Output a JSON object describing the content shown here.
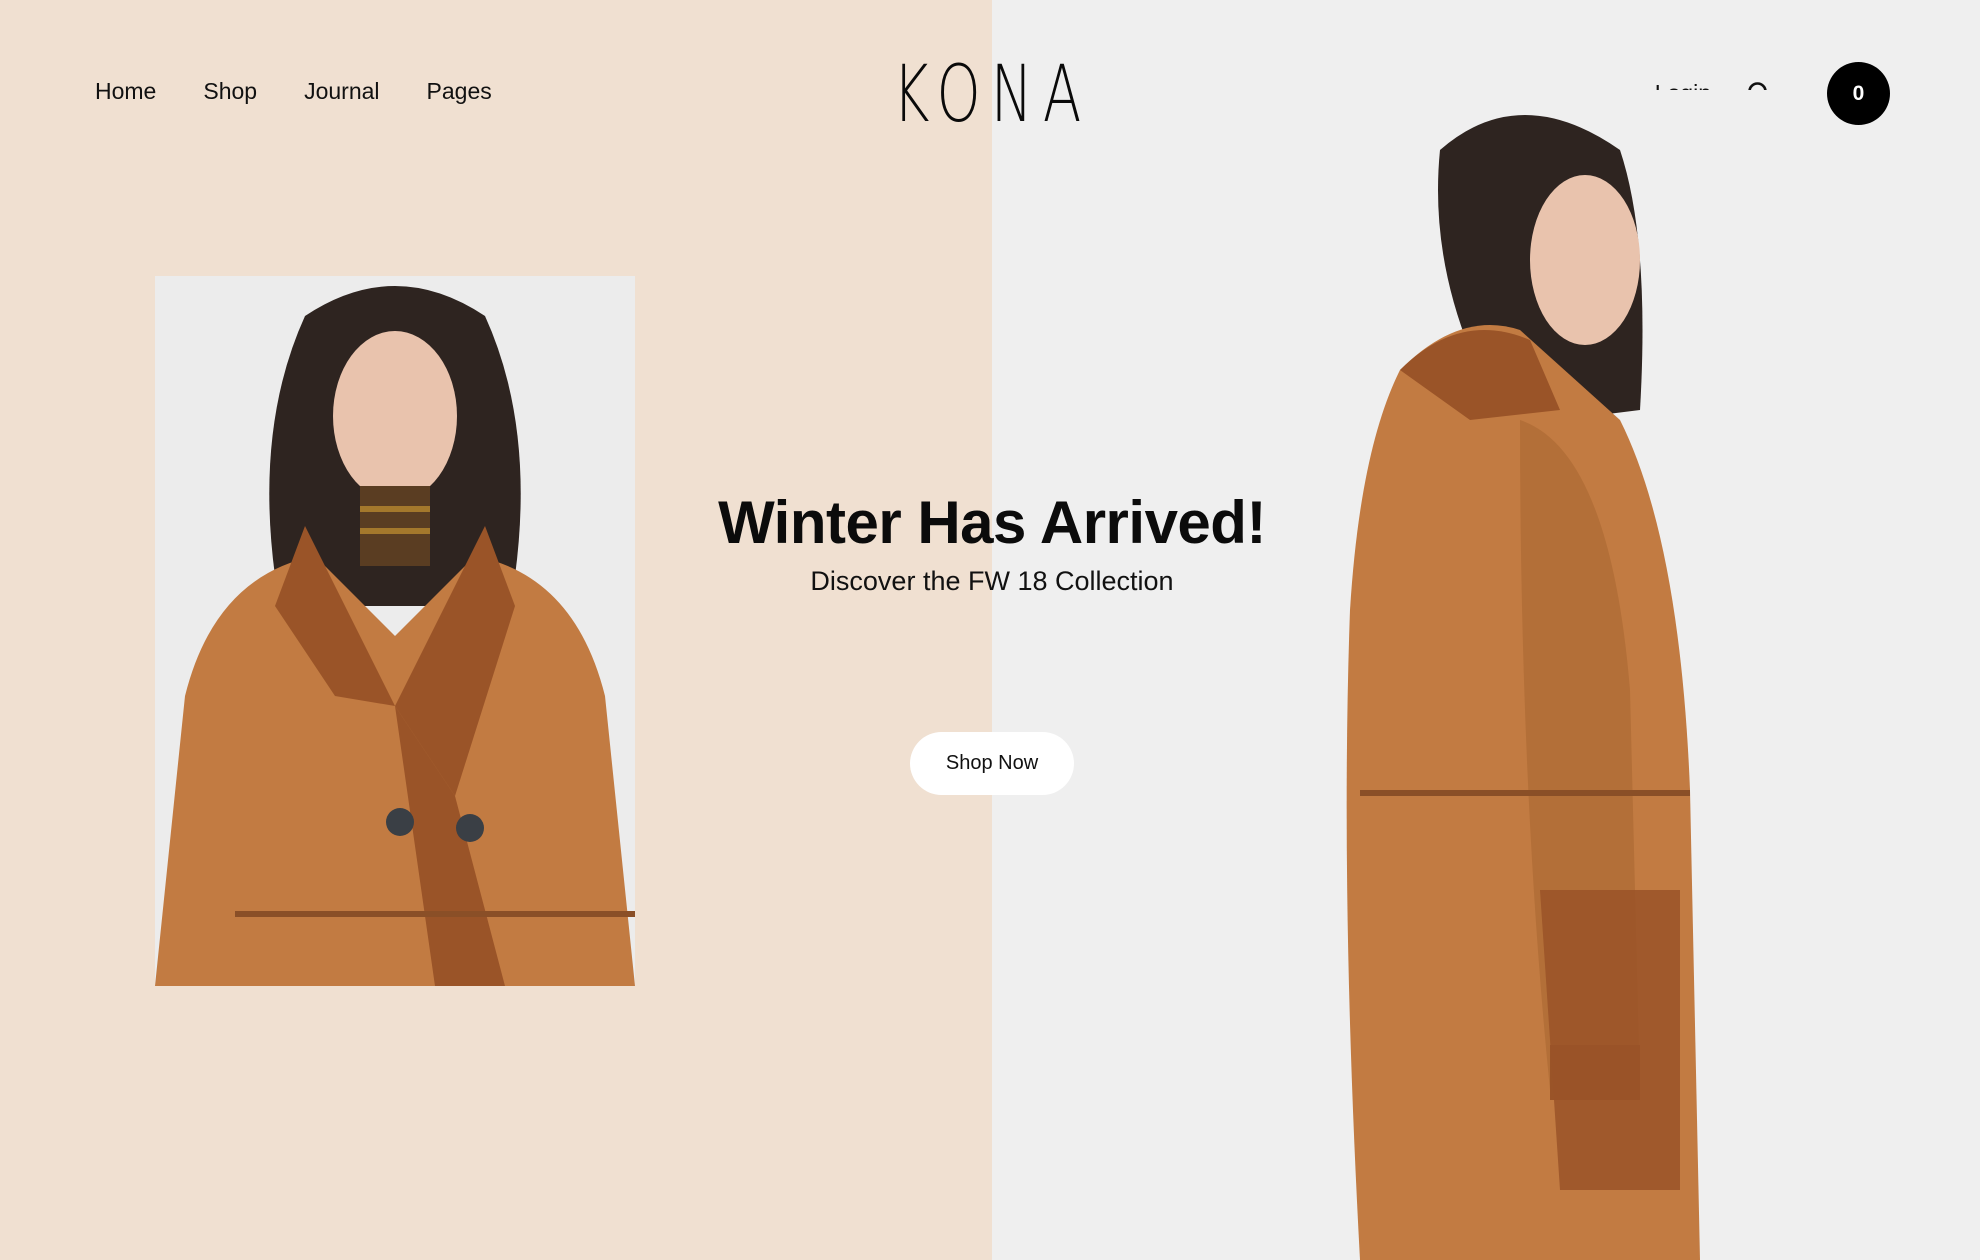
{
  "nav": {
    "links": [
      "Home",
      "Shop",
      "Journal",
      "Pages"
    ],
    "login": "Login",
    "cart_count": "0"
  },
  "brand": {
    "logo": "KONA"
  },
  "hero": {
    "title": "Winter Has Arrived!",
    "subtitle": "Discover the FW 18 Collection",
    "cta": "Shop Now"
  },
  "colors": {
    "left_background": "#f0e0d1",
    "right_background": "#efefef",
    "coat": "#c27b42",
    "cart_button": "#000000"
  },
  "icons": {
    "search": "search-icon"
  }
}
